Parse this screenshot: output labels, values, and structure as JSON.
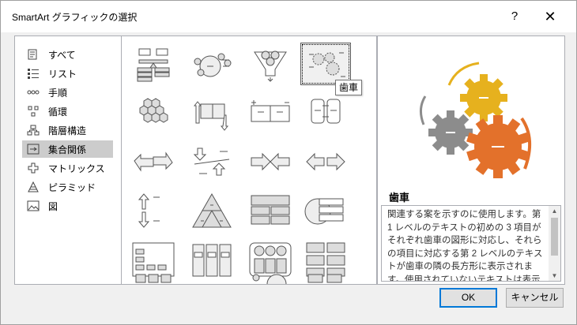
{
  "window": {
    "title": "SmartArt グラフィックの選択",
    "help_label": "?",
    "close_label": "✕"
  },
  "categories": [
    {
      "label": "すべて",
      "icon": "all-icon",
      "selected": false
    },
    {
      "label": "リスト",
      "icon": "list-icon",
      "selected": false
    },
    {
      "label": "手順",
      "icon": "process-icon",
      "selected": false
    },
    {
      "label": "循環",
      "icon": "cycle-icon",
      "selected": false
    },
    {
      "label": "階層構造",
      "icon": "hierarchy-icon",
      "selected": false
    },
    {
      "label": "集合関係",
      "icon": "relationship-icon",
      "selected": true
    },
    {
      "label": "マトリックス",
      "icon": "matrix-icon",
      "selected": false
    },
    {
      "label": "ピラミッド",
      "icon": "pyramid-icon",
      "selected": false
    },
    {
      "label": "図",
      "icon": "picture-icon",
      "selected": false
    }
  ],
  "gallery": {
    "tooltip": "歯車",
    "selected_index": 3
  },
  "preview": {
    "title": "歯車",
    "description": "関連する案を示すのに使用します。第 1 レベルのテキストの初めの 3 項目がそれぞれ歯車の図形に対応し、それらの項目に対応する第 2 レベルのテキストが歯車の隣の長方形に表示されます。使用されていないテキストは表示されませんが、レイアウトを切り替えても使用できます。",
    "gear_colors": {
      "yellow": "#e6b11e",
      "gray": "#8c8c8c",
      "orange": "#e3712b"
    }
  },
  "buttons": {
    "ok": "OK",
    "cancel": "キャンセル"
  }
}
